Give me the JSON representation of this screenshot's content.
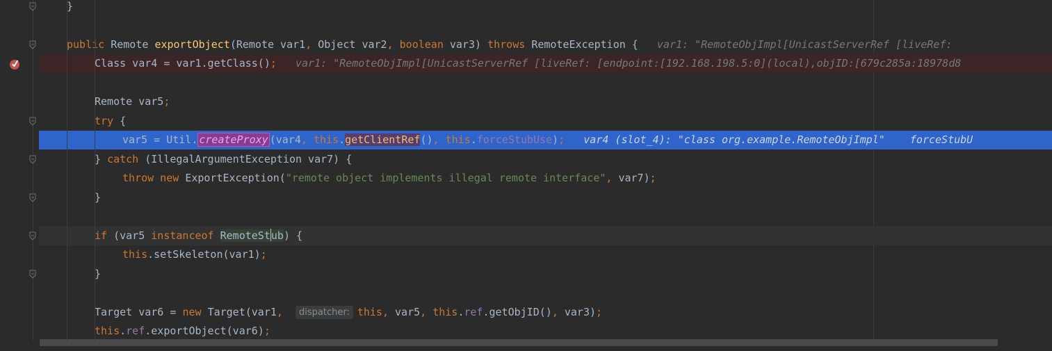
{
  "editor": {
    "lines": [
      {
        "segments": [
          {
            "t": "}",
            "c": "cls"
          }
        ]
      },
      {
        "segments": []
      },
      {
        "segments": [
          {
            "t": "public ",
            "c": "kw"
          },
          {
            "t": "Remote ",
            "c": "cls"
          },
          {
            "t": "exportObject",
            "c": "fn"
          },
          {
            "t": "(Remote var1",
            "c": "cls"
          },
          {
            "t": ", ",
            "c": "kw"
          },
          {
            "t": "Object var2",
            "c": "cls"
          },
          {
            "t": ", ",
            "c": "kw"
          },
          {
            "t": "boolean ",
            "c": "kw"
          },
          {
            "t": "var3) ",
            "c": "cls"
          },
          {
            "t": "throws ",
            "c": "kw"
          },
          {
            "t": "RemoteException {",
            "c": "cls"
          },
          {
            "t": "   var1: \"RemoteObjImpl[UnicastServerRef [liveRef: ",
            "c": "inline-val"
          }
        ]
      },
      {
        "segments": [
          {
            "t": "Class var4 = var1.getClass()",
            "c": "cls"
          },
          {
            "t": ";",
            "c": "kw"
          },
          {
            "t": "   var1: \"RemoteObjImpl[UnicastServerRef [liveRef: [endpoint:[192.168.198.5:0](local),objID:[679c285a:18978d8",
            "c": "inline-val"
          }
        ]
      },
      {
        "segments": []
      },
      {
        "segments": [
          {
            "t": "Remote var5",
            "c": "cls"
          },
          {
            "t": ";",
            "c": "kw"
          }
        ]
      },
      {
        "segments": [
          {
            "t": "try ",
            "c": "kw"
          },
          {
            "t": "{",
            "c": "cls"
          }
        ]
      },
      {
        "segments": [
          {
            "t": "var5 = Util.",
            "c": "cls"
          },
          {
            "t": "createProxy",
            "c": "hl-proxy"
          },
          {
            "t": "(var4",
            "c": "cls"
          },
          {
            "t": ", ",
            "c": "kw"
          },
          {
            "t": "this",
            "c": "kw"
          },
          {
            "t": ".",
            "c": "cls"
          },
          {
            "t": "getClientRef",
            "c": "hl-ref"
          },
          {
            "t": "()",
            "c": "cls"
          },
          {
            "t": ", ",
            "c": "kw"
          },
          {
            "t": "this",
            "c": "kw"
          },
          {
            "t": ".",
            "c": "cls"
          },
          {
            "t": "forceStubUse",
            "c": "fld"
          },
          {
            "t": ")",
            "c": "cls"
          },
          {
            "t": ";",
            "c": "kw"
          },
          {
            "t": "   var4 (slot_4): \"class org.example.RemoteObjImpl\"    forceStubU",
            "c": "inline-val"
          }
        ]
      },
      {
        "segments": [
          {
            "t": "} ",
            "c": "cls"
          },
          {
            "t": "catch ",
            "c": "kw"
          },
          {
            "t": "(IllegalArgumentException var7) {",
            "c": "cls"
          }
        ]
      },
      {
        "segments": [
          {
            "t": "throw new ",
            "c": "kw"
          },
          {
            "t": "ExportException(",
            "c": "cls"
          },
          {
            "t": "\"remote object implements illegal remote interface\"",
            "c": "str"
          },
          {
            "t": ", ",
            "c": "kw"
          },
          {
            "t": "var7)",
            "c": "cls"
          },
          {
            "t": ";",
            "c": "kw"
          }
        ]
      },
      {
        "segments": [
          {
            "t": "}",
            "c": "cls"
          }
        ]
      },
      {
        "segments": []
      },
      {
        "segments": [
          {
            "t": "if ",
            "c": "kw"
          },
          {
            "t": "(var5 ",
            "c": "cls"
          },
          {
            "t": "instanceof ",
            "c": "kw"
          },
          {
            "t": "RemoteSt",
            "c": "hl-stub"
          },
          {
            "t": "CARET",
            "c": "caret"
          },
          {
            "t": "ub",
            "c": "hl-stub"
          },
          {
            "t": ") {",
            "c": "cls"
          }
        ]
      },
      {
        "segments": [
          {
            "t": "this",
            "c": "kw"
          },
          {
            "t": ".setSkeleton(var1)",
            "c": "cls"
          },
          {
            "t": ";",
            "c": "kw"
          }
        ]
      },
      {
        "segments": [
          {
            "t": "}",
            "c": "cls"
          }
        ]
      },
      {
        "segments": []
      },
      {
        "segments": [
          {
            "t": "Target var6 = ",
            "c": "cls"
          },
          {
            "t": "new ",
            "c": "kw"
          },
          {
            "t": "Target(var1",
            "c": "cls"
          },
          {
            "t": ",  ",
            "c": "kw"
          },
          {
            "t": "dispatcher:",
            "c": "hint"
          },
          {
            "t": "this",
            "c": "kw"
          },
          {
            "t": ", ",
            "c": "kw"
          },
          {
            "t": "var5",
            "c": "cls"
          },
          {
            "t": ", ",
            "c": "kw"
          },
          {
            "t": "this",
            "c": "kw"
          },
          {
            "t": ".",
            "c": "cls"
          },
          {
            "t": "ref",
            "c": "fld"
          },
          {
            "t": ".getObjID()",
            "c": "cls"
          },
          {
            "t": ", ",
            "c": "kw"
          },
          {
            "t": "var3)",
            "c": "cls"
          },
          {
            "t": ";",
            "c": "kw"
          }
        ]
      },
      {
        "segments": [
          {
            "t": "this",
            "c": "kw"
          },
          {
            "t": ".",
            "c": "cls"
          },
          {
            "t": "ref",
            "c": "fld"
          },
          {
            "t": ".exportObject(var6)",
            "c": "cls"
          },
          {
            "t": ";",
            "c": "kw"
          }
        ]
      }
    ]
  },
  "colors": {
    "background": "#2b2b2b",
    "keyword": "#cc7832",
    "method": "#ffc66d",
    "field": "#9876aa",
    "string": "#6a8759",
    "execution_line": "#2f65ca",
    "breakpoint": "#c75450"
  },
  "icons": {
    "breakpoint": "breakpoint-check-icon",
    "fold": "fold-marker-icon"
  }
}
